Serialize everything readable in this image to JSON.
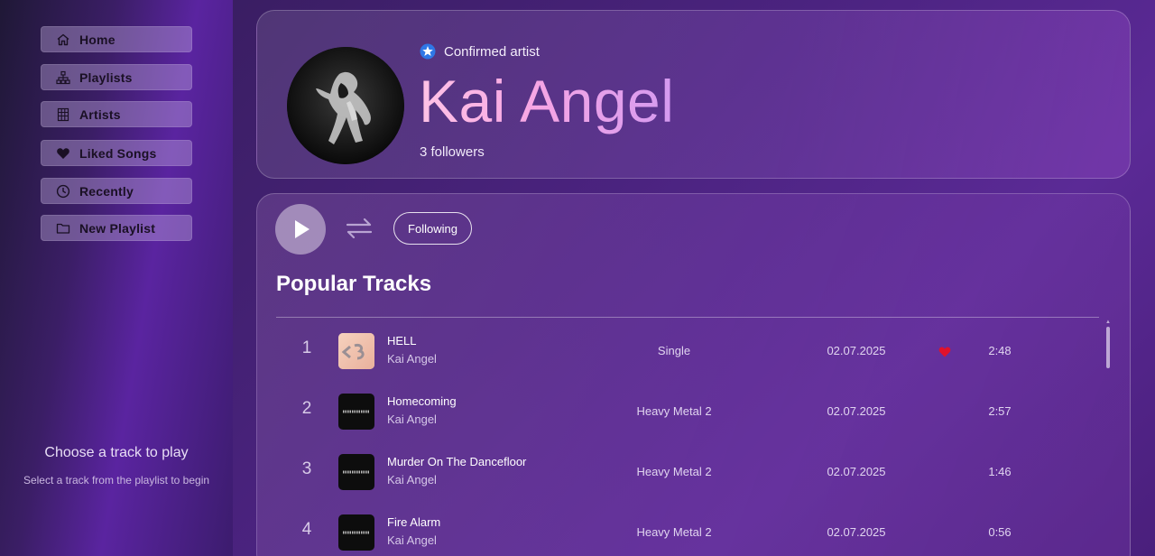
{
  "sidebar": {
    "nav": [
      {
        "label": "Home",
        "icon": "home-icon"
      },
      {
        "label": "Playlists",
        "icon": "playlists-icon"
      },
      {
        "label": "Artists",
        "icon": "artists-icon"
      },
      {
        "label": "Liked Songs",
        "icon": "heart-icon"
      },
      {
        "label": "Recently",
        "icon": "clock-icon"
      },
      {
        "label": "New Playlist",
        "icon": "folder-icon"
      }
    ],
    "now_playing": {
      "title": "Choose a track to play",
      "subtitle": "Select a track from the playlist to begin"
    }
  },
  "artist": {
    "badge": "Confirmed artist",
    "name": "Kai Angel",
    "followers": "3 followers"
  },
  "controls": {
    "following_label": "Following"
  },
  "section": {
    "title": "Popular Tracks"
  },
  "tracks": [
    {
      "num": "1",
      "title": "HELL",
      "artist": "Kai Angel",
      "album": "Single",
      "date": "02.07.2025",
      "liked": true,
      "duration": "2:48",
      "art": "hell"
    },
    {
      "num": "2",
      "title": "Homecoming",
      "artist": "Kai Angel",
      "album": "Heavy Metal 2",
      "date": "02.07.2025",
      "liked": false,
      "duration": "2:57",
      "art": "hm2"
    },
    {
      "num": "3",
      "title": "Murder On The Dancefloor",
      "artist": "Kai Angel",
      "album": "Heavy Metal 2",
      "date": "02.07.2025",
      "liked": false,
      "duration": "1:46",
      "art": "hm2"
    },
    {
      "num": "4",
      "title": "Fire Alarm",
      "artist": "Kai Angel",
      "album": "Heavy Metal 2",
      "date": "02.07.2025",
      "liked": false,
      "duration": "0:56",
      "art": "hm2"
    }
  ],
  "colors": {
    "accent_pink": "#f7a6e4",
    "heart_red": "#e0122b",
    "verified_blue": "#3d8bf2"
  }
}
